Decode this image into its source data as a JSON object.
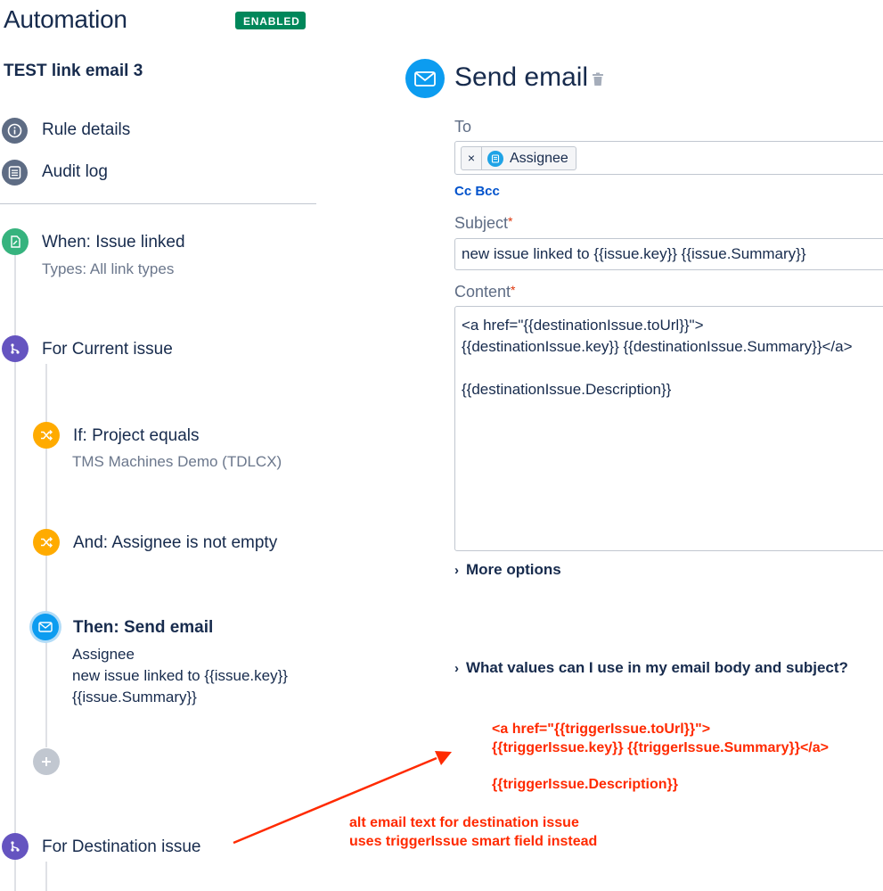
{
  "header": {
    "title": "Automation",
    "status_badge": "ENABLED"
  },
  "rule": {
    "name": "TEST link email 3"
  },
  "nav": [
    {
      "label": "Rule details",
      "icon": "info-icon"
    },
    {
      "label": "Audit log",
      "icon": "list-icon"
    }
  ],
  "flow": {
    "trigger": {
      "label": "When: Issue linked",
      "sub": "Types: All link types"
    },
    "branch1": {
      "label": "For Current issue"
    },
    "condition1": {
      "label": "If: Project equals",
      "sub": "TMS Machines Demo (TDLCX)"
    },
    "condition2": {
      "label": "And: Assignee is not empty"
    },
    "action": {
      "label": "Then: Send email",
      "sub1": "Assignee",
      "sub2": "new issue linked to {{issue.key}}",
      "sub3": "{{issue.Summary}}"
    },
    "branch2": {
      "label": "For Destination issue"
    }
  },
  "panel": {
    "title": "Send email",
    "to_label": "To",
    "to_chip_remove": "×",
    "to_chip": "Assignee",
    "cc_bcc": "Cc Bcc",
    "subject_label": "Subject",
    "required_mark": "*",
    "subject_value": "new issue linked to {{issue.key}} {{issue.Summary}}",
    "content_label": "Content",
    "content_line1": "<a href=\"{{destinationIssue.toUrl}}\">",
    "content_line2": "{{destinationIssue.key}} {{destinationIssue.Summary}}</a>",
    "content_line3": "{{destinationIssue.Description}}",
    "more_options": "More options",
    "help_link": "What values can I use in my email body and subject?"
  },
  "annotation": {
    "code_line1": "<a href=\"{{triggerIssue.toUrl}}\">",
    "code_line2": "{{triggerIssue.key}} {{triggerIssue.Summary}}</a>",
    "code_line3": "{{triggerIssue.Description}}",
    "note_line1": "alt email text for destination issue",
    "note_line2": "uses triggerIssue smart field instead"
  },
  "colors": {
    "brand_text": "#172b4d",
    "enabled_green": "#00875a",
    "trigger_green": "#36b37e",
    "branch_purple": "#6554c0",
    "condition_orange": "#ffab00",
    "action_blue": "#0c9cf0",
    "annotation_red": "#ff2a00",
    "link_blue": "#0052cc"
  }
}
